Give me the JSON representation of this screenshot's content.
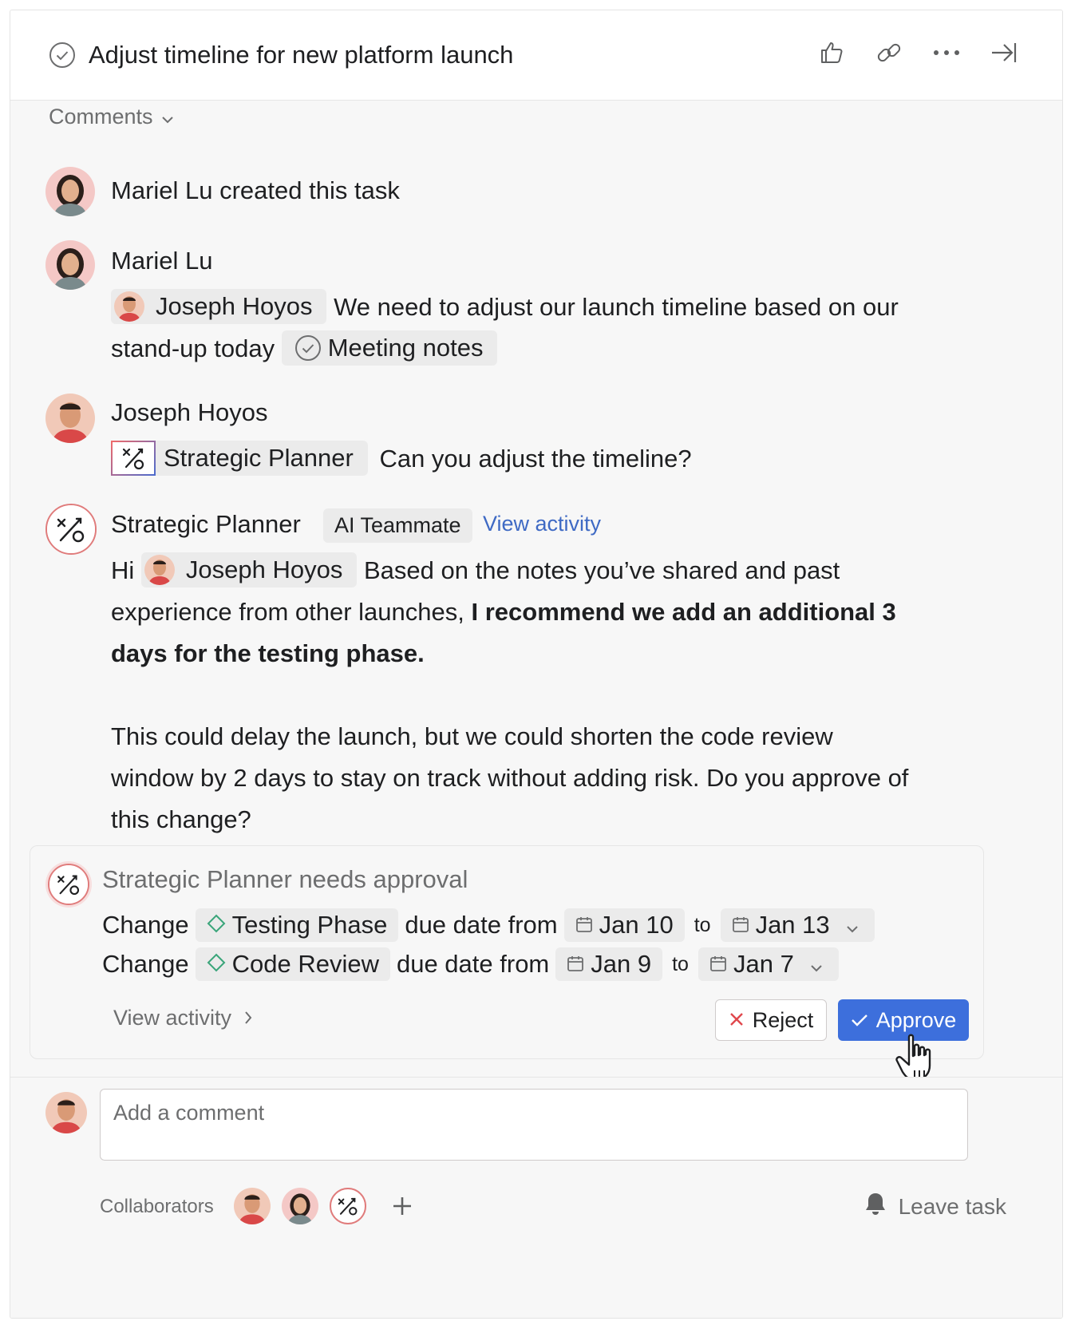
{
  "task": {
    "title": "Adjust timeline for new platform launch",
    "icons": [
      "check-circle-icon",
      "thumbs-up-icon",
      "link-icon",
      "more-icon",
      "close-pane-icon"
    ]
  },
  "comments_toggle": "Comments",
  "feed": {
    "story": "Mariel Lu created this task",
    "comment1": {
      "author": "Mariel Lu",
      "mention": "Joseph Hoyos",
      "text_a": "We need to adjust our launch timeline based on our",
      "text_b": "stand-up today",
      "task_link": "Meeting notes"
    },
    "comment2": {
      "author": "Joseph Hoyos",
      "agent_mention": "Strategic Planner",
      "text": "Can you adjust the timeline?"
    },
    "comment3": {
      "author": "Strategic Planner",
      "badge": "AI Teammate",
      "view_activity": "View activity",
      "greeting": "Hi",
      "mention": "Joseph Hoyos",
      "text_a": "Based on the notes you’ve shared and past",
      "text_b": "experience from other launches,",
      "bold_a": "I recommend we add an additional 3",
      "bold_b": "days for the testing phase.",
      "para2_a": "This could delay the launch, but we could shorten the code review",
      "para2_b": "window by 2 days to stay on track without adding risk. Do you approve of",
      "para2_c": "this change?"
    }
  },
  "approval": {
    "agent": "Strategic Planner",
    "status": "needs approval",
    "changes": [
      {
        "verb": "Change",
        "task": "Testing Phase",
        "mid": "due date from",
        "from": "Jan 10",
        "to_word": "to",
        "to": "Jan 13"
      },
      {
        "verb": "Change",
        "task": "Code Review",
        "mid": "due date from",
        "from": "Jan 9",
        "to_word": "to",
        "to": "Jan 7"
      }
    ],
    "view_activity": "View activity",
    "reject": "Reject",
    "approve": "Approve"
  },
  "composer": {
    "placeholder": "Add a comment",
    "collaborators_label": "Collaborators",
    "leave_task": "Leave task"
  },
  "colors": {
    "accent_blue": "#3d6fdc",
    "link_blue": "#3f6ac4",
    "reject_red": "#e0474c"
  }
}
